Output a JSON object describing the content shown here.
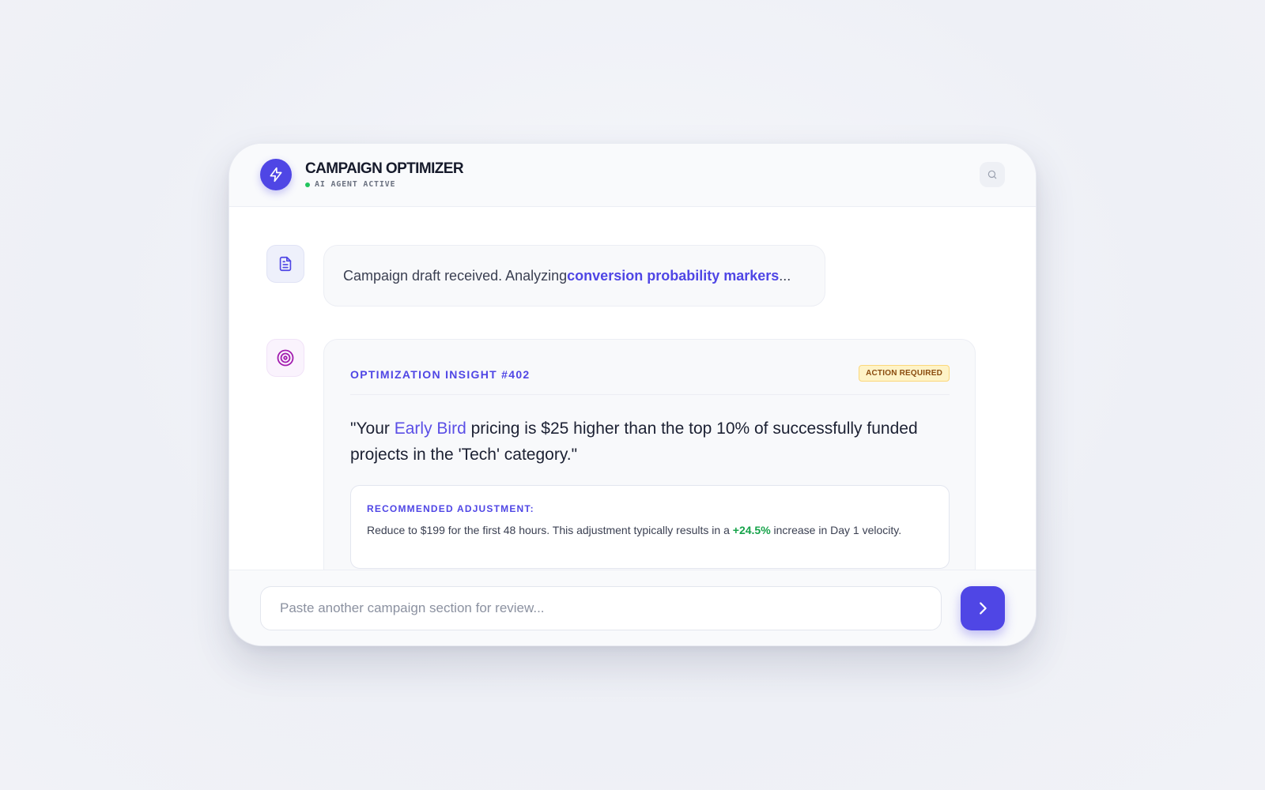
{
  "app": {
    "title": "CAMPAIGN OPTIMIZER",
    "status": "AI AGENT ACTIVE",
    "logo_icon": "lightning-bolt-icon",
    "accent_color": "#4f46e5",
    "status_color": "#22c55e"
  },
  "header": {
    "search_icon": "search-icon"
  },
  "messages": [
    {
      "icon": "document-icon",
      "text_before": "Campaign draft received. Analyzing ",
      "highlight": "conversion probability markers",
      "text_after": "..."
    },
    {
      "icon": "target-icon",
      "title": "OPTIMIZATION INSIGHT #402",
      "badge": "ACTION REQUIRED",
      "quote_before": "\"Your ",
      "quote_highlight": "Early Bird",
      "quote_after": " pricing is $25 higher than the top 10% of successfully funded projects in the 'Tech' category.\"",
      "recommendation": {
        "label": "RECOMMENDED ADJUSTMENT:",
        "text_before": "Reduce to $199 for the first 48 hours. This adjustment typically results in a ",
        "highlight": "+24.5%",
        "text_after": " increase in Day 1 velocity."
      }
    }
  ],
  "composer": {
    "placeholder": "Paste another campaign section for review...",
    "send_icon": "chevron-right-icon"
  }
}
